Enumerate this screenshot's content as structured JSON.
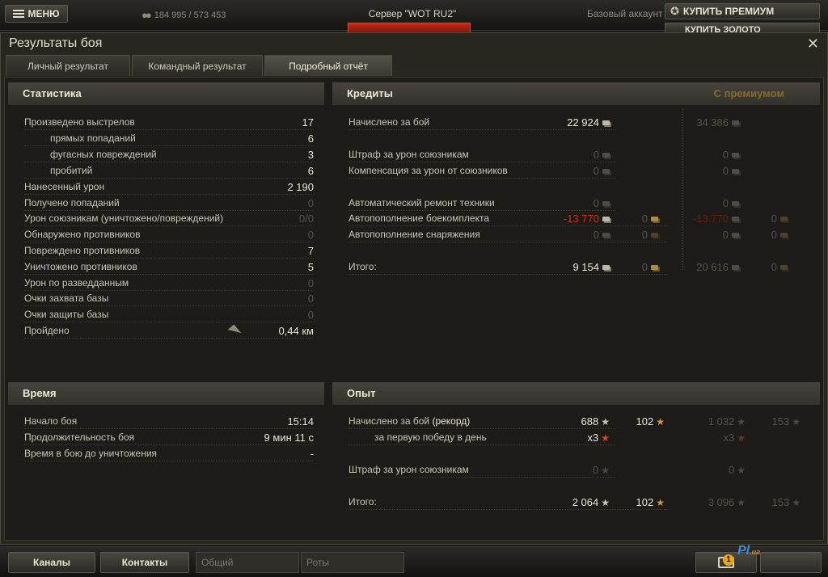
{
  "topbar": {
    "menu_label": "МЕНЮ",
    "online": "184 995 / 573 453",
    "server": "Сервер \"WOT RU2\"",
    "account": "Базовый аккаунт",
    "buy_premium": "КУПИТЬ ПРЕМИУМ",
    "buy_gold": "КУПИТЬ ЗОЛОТО"
  },
  "window": {
    "title": "Результаты боя",
    "close": "✕",
    "tabs": [
      "Личный результат",
      "Командный результат",
      "Подробный отчёт"
    ]
  },
  "stats": {
    "title": "Статистика",
    "rows": [
      {
        "label": "Произведено выстрелов",
        "value": "17",
        "dim": false,
        "indent": false
      },
      {
        "label": "прямых попаданий",
        "value": "6",
        "dim": false,
        "indent": true
      },
      {
        "label": "фугасных повреждений",
        "value": "3",
        "dim": false,
        "indent": true
      },
      {
        "label": "пробитий",
        "value": "6",
        "dim": false,
        "indent": true
      },
      {
        "label": "Нанесенный урон",
        "value": "2 190",
        "dim": false,
        "indent": false
      },
      {
        "label": "Получено попаданий",
        "value": "0",
        "dim": true,
        "indent": false
      },
      {
        "label": "Урон союзникам (уничтожено/повреждений)",
        "value": "0/0",
        "dim": true,
        "indent": false
      },
      {
        "label": "Обнаружено противников",
        "value": "0",
        "dim": true,
        "indent": false
      },
      {
        "label": "Повреждено противников",
        "value": "7",
        "dim": false,
        "indent": false
      },
      {
        "label": "Уничтожено противников",
        "value": "5",
        "dim": false,
        "indent": false
      },
      {
        "label": "Урон по разведданным",
        "value": "0",
        "dim": true,
        "indent": false
      },
      {
        "label": "Очки захвата базы",
        "value": "0",
        "dim": true,
        "indent": false
      },
      {
        "label": "Очки защиты базы",
        "value": "0",
        "dim": true,
        "indent": false
      },
      {
        "label": "Пройдено",
        "value": "0,44 км",
        "dim": false,
        "indent": false
      }
    ]
  },
  "time": {
    "title": "Время",
    "rows": [
      {
        "label": "Начало боя",
        "value": "15:14"
      },
      {
        "label": "Продолжительность боя",
        "value": "9 мин 11 с"
      },
      {
        "label": "Время в бою до уничтожения",
        "value": "-"
      }
    ]
  },
  "credits": {
    "title": "Кредиты",
    "premium_title": "С премиумом",
    "labels": {
      "earned": "Начислено за бой",
      "fine": "Штраф за урон союзникам",
      "comp": "Компенсация за урон от союзников",
      "repair": "Автоматический ремонт техники",
      "ammo": "Автопополнение боекомплекта",
      "equip": "Автопополнение снаряжения",
      "total": "Итого:"
    },
    "values": {
      "earned": "22 924",
      "earned_p": "34 386",
      "fine": "0",
      "fine_p": "0",
      "comp": "0",
      "comp_p": "0",
      "repair": "0",
      "repair_p": "0",
      "ammo": "-13 770",
      "ammo_g": "0",
      "ammo_p": "-13 770",
      "ammo_pg": "0",
      "equip": "0",
      "equip_g": "0",
      "equip_p": "0",
      "equip_pg": "0",
      "total": "9 154",
      "total_g": "0",
      "total_p": "20 616",
      "total_pg": "0"
    }
  },
  "xp": {
    "title": "Опыт",
    "labels": {
      "earned": "Начислено за бой",
      "record": "(рекорд)",
      "first_win": "за первую победу в день",
      "fine": "Штраф за урон союзникам",
      "total": "Итого:"
    },
    "values": {
      "earned": "688",
      "earned_free": "102",
      "earned_p": "1 032",
      "earned_pfree": "153",
      "mult": "x3",
      "mult_p": "x3",
      "fine": "0",
      "fine_p": "0",
      "total": "2 064",
      "total_free": "102",
      "total_p": "3 096",
      "total_pfree": "153"
    }
  },
  "bottom": {
    "channels": "Каналы",
    "contacts": "Контакты",
    "common": "Общий",
    "companies": "Роты",
    "badge": "1"
  },
  "watermark": {
    "main": "Pl",
    "sub": ".ua"
  }
}
